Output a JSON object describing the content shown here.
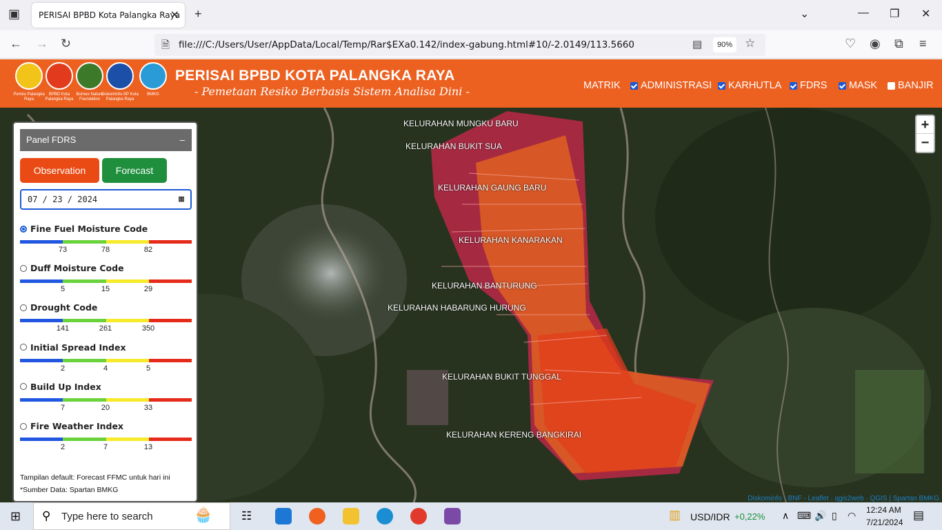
{
  "browser": {
    "tab_title": "PERISAI BPBD Kota Palangka Raya",
    "url": "file:///C:/Users/User/AppData/Local/Temp/Rar$EXa0.142/index-gabung.html#10/-2.0149/113.5660",
    "zoom": "90%"
  },
  "header": {
    "title": "PERISAI BPBD KOTA PALANGKA RAYA",
    "subtitle": "- Pemetaan Resiko Berbasis Sistem Analisa Dini -",
    "logos": [
      {
        "caption": "Pemko Palangka Raya",
        "color": "#f2c318"
      },
      {
        "caption": "BPBD Kota Palangka Raya",
        "color": "#e23a1c"
      },
      {
        "caption": "Borneo Nature Foundation",
        "color": "#3c7a2a"
      },
      {
        "caption": "Diskominfo-SP Kota Palangka Raya",
        "color": "#1b4fa8"
      },
      {
        "caption": "BMKG",
        "color": "#2a9bd6"
      }
    ],
    "menu": [
      {
        "label": "MATRIK",
        "checkbox": false,
        "checked": false
      },
      {
        "label": "ADMINISTRASI",
        "checkbox": true,
        "checked": true
      },
      {
        "label": "KARHUTLA",
        "checkbox": true,
        "checked": true
      },
      {
        "label": "FDRS",
        "checkbox": true,
        "checked": true
      },
      {
        "label": "MASK",
        "checkbox": true,
        "checked": true
      },
      {
        "label": "BANJIR",
        "checkbox": true,
        "checked": false
      }
    ]
  },
  "panel": {
    "title": "Panel FDRS",
    "minimize": "–",
    "btn_observation": "Observation",
    "btn_forecast": "Forecast",
    "date": "07 / 23 / 2024",
    "indices": [
      {
        "label": "Fine Fuel Moisture Code",
        "selected": true,
        "ticks": [
          "73",
          "78",
          "82"
        ]
      },
      {
        "label": "Duff Moisture Code",
        "selected": false,
        "ticks": [
          "5",
          "15",
          "29"
        ]
      },
      {
        "label": "Drought Code",
        "selected": false,
        "ticks": [
          "141",
          "261",
          "350"
        ]
      },
      {
        "label": "Initial Spread Index",
        "selected": false,
        "ticks": [
          "2",
          "4",
          "5"
        ]
      },
      {
        "label": "Build Up Index",
        "selected": false,
        "ticks": [
          "7",
          "20",
          "33"
        ]
      },
      {
        "label": "Fire Weather Index",
        "selected": false,
        "ticks": [
          "2",
          "7",
          "13"
        ]
      }
    ],
    "scale_colors": [
      "#2156e0",
      "#6ad23a",
      "#f7ea2a",
      "#e52a1a"
    ],
    "note1": "Tampilan default: Forecast FFMC untuk hari ini",
    "note2": "*Sumber Data: Spartan BMKG"
  },
  "map": {
    "kelurahan": [
      "KELURAHAN MUNGKU BARU",
      "KELURAHAN BUKIT SUA",
      "KELURAHAN GAUNG BARU",
      "KELURAHAN KANARAKAN",
      "KELURAHAN BANTURUNG",
      "KELURAHAN HABARUNG HURUNG",
      "KELURAHAN BUKIT TUNGGAL",
      "KELURAHAN KERENG BANGKIRAI"
    ],
    "zoom_in": "+",
    "zoom_out": "−",
    "attribution": "Diskominfo - BNF - Leaflet · qgis2web · QGIS | Spartan BMKG"
  },
  "taskbar": {
    "search_placeholder": "Type here to search",
    "ticker": "USD/IDR",
    "ticker_change": "+0,22%",
    "time": "12:24 AM",
    "date": "7/21/2024"
  }
}
